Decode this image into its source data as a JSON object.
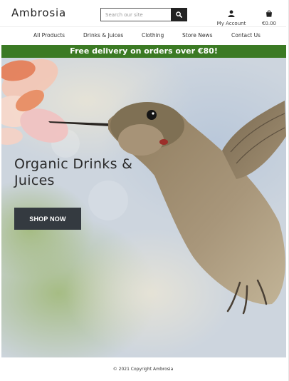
{
  "header": {
    "logo": "Ambrosia",
    "search": {
      "placeholder": "Search our site",
      "value": ""
    },
    "account_label": "My Account",
    "cart_total": "€0.00"
  },
  "icons": {
    "search": "search-icon",
    "account": "user-icon",
    "cart": "shopping-bag-icon"
  },
  "nav": {
    "items": [
      {
        "label": "All Products"
      },
      {
        "label": "Drinks & Juices"
      },
      {
        "label": "Clothing"
      },
      {
        "label": "Store News"
      },
      {
        "label": "Contact Us"
      }
    ]
  },
  "banner": {
    "text": "Free delivery on orders over €80!"
  },
  "hero": {
    "title": "Organic Drinks & Juices",
    "cta_label": "SHOP NOW"
  },
  "footer": {
    "copyright": "© 2021 Copyright Ambrosia"
  },
  "colors": {
    "banner": "#3b7a24",
    "button": "#343a40",
    "text": "#222222"
  }
}
